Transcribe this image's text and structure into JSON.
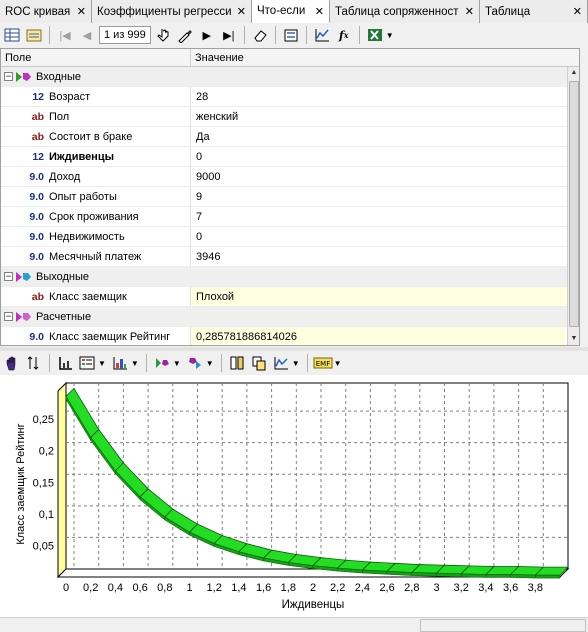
{
  "tabs": [
    {
      "label": "ROC кривая",
      "active": false
    },
    {
      "label": "Коэффициенты регрессии",
      "active": false
    },
    {
      "label": "Что-если",
      "active": true
    },
    {
      "label": "Таблица сопряженности",
      "active": false
    },
    {
      "label": "Таблица",
      "active": false
    }
  ],
  "toolbar": {
    "page_indicator": "1 из 999"
  },
  "grid": {
    "col_field": "Поле",
    "col_value": "Значение",
    "groups": [
      {
        "name": "Входные",
        "rows": [
          {
            "type": "12",
            "name": "Возраст",
            "value": "28",
            "bold": false
          },
          {
            "type": "ab",
            "name": "Пол",
            "value": "женский",
            "bold": false
          },
          {
            "type": "ab",
            "name": "Состоит в браке",
            "value": "Да",
            "bold": false
          },
          {
            "type": "12",
            "name": "Иждивенцы",
            "value": "0",
            "bold": true
          },
          {
            "type": "9.0",
            "name": "Доход",
            "value": "9000",
            "bold": false
          },
          {
            "type": "9.0",
            "name": "Опыт работы",
            "value": "9",
            "bold": false
          },
          {
            "type": "9.0",
            "name": "Срок проживания",
            "value": "7",
            "bold": false
          },
          {
            "type": "9.0",
            "name": "Недвижимость",
            "value": "0",
            "bold": false
          },
          {
            "type": "9.0",
            "name": "Месячный платеж",
            "value": "3946",
            "bold": false
          }
        ]
      },
      {
        "name": "Выходные",
        "rows": [
          {
            "type": "ab",
            "name": "Класс заемщик",
            "value": "Плохой",
            "bold": false,
            "hl": true
          }
        ]
      },
      {
        "name": "Расчетные",
        "rows": [
          {
            "type": "9.0",
            "name": "Класс заемщик Рейтинг",
            "value": "0,285781886814026",
            "bold": false,
            "hl": true
          }
        ]
      }
    ]
  },
  "chart_data": {
    "type": "area",
    "title": "",
    "xlabel": "Иждивенцы",
    "ylabel": "Класс заемщик Рейтинг",
    "xlim": [
      0,
      4
    ],
    "ylim": [
      0,
      0.285
    ],
    "x_ticks": [
      "0",
      "0,2",
      "0,4",
      "0,6",
      "0,8",
      "1",
      "1,2",
      "1,4",
      "1,6",
      "1,8",
      "2",
      "2,2",
      "2,4",
      "2,6",
      "2,8",
      "3",
      "3,2",
      "3,4",
      "3,6",
      "3,8"
    ],
    "y_ticks": [
      "0,05",
      "0,1",
      "0,15",
      "0,2",
      "0,25"
    ],
    "series": [
      {
        "color": "#22dd22",
        "x": [
          0,
          0.2,
          0.4,
          0.6,
          0.8,
          1.0,
          1.2,
          1.4,
          1.6,
          1.8,
          2.0,
          2.2,
          2.4,
          2.6,
          2.8,
          3.0,
          3.2,
          3.4,
          3.6,
          3.8,
          4.0
        ],
        "y": [
          0.286,
          0.221,
          0.168,
          0.127,
          0.095,
          0.071,
          0.053,
          0.04,
          0.03,
          0.023,
          0.018,
          0.014,
          0.011,
          0.009,
          0.007,
          0.006,
          0.005,
          0.004,
          0.004,
          0.003,
          0.003
        ]
      }
    ],
    "grid": true
  }
}
